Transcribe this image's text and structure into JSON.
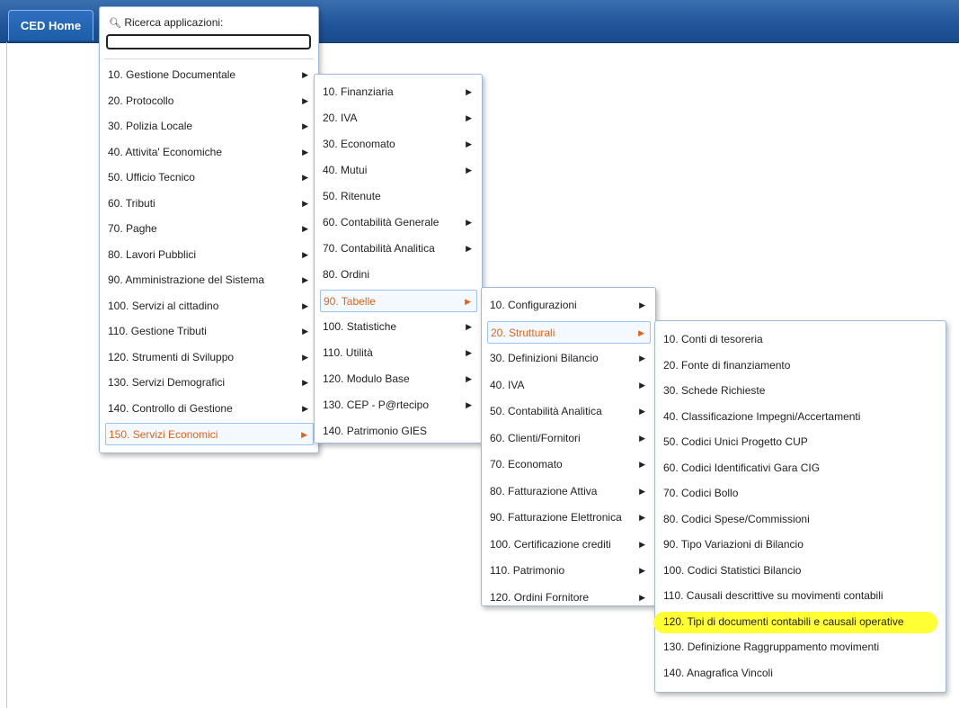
{
  "tabs": {
    "home": "CED Home"
  },
  "search": {
    "label": "Ricerca applicazioni:",
    "icon": "search-icon",
    "value": ""
  },
  "menu1": [
    {
      "label": "10. Gestione Documentale"
    },
    {
      "label": "20. Protocollo"
    },
    {
      "label": "30. Polizia Locale"
    },
    {
      "label": "40. Attivita' Economiche"
    },
    {
      "label": "50. Ufficio Tecnico"
    },
    {
      "label": "60. Tributi"
    },
    {
      "label": "70. Paghe"
    },
    {
      "label": "80. Lavori Pubblici"
    },
    {
      "label": "90. Amministrazione del Sistema"
    },
    {
      "label": "100. Servizi al cittadino"
    },
    {
      "label": "110. Gestione Tributi"
    },
    {
      "label": "120. Strumenti di Sviluppo"
    },
    {
      "label": "130. Servizi Demografici"
    },
    {
      "label": "140. Controllo di Gestione"
    },
    {
      "label": "150. Servizi Economici"
    }
  ],
  "menu2": [
    {
      "label": "10. Finanziaria"
    },
    {
      "label": "20. IVA"
    },
    {
      "label": "30. Economato"
    },
    {
      "label": "40. Mutui"
    },
    {
      "label": "50. Ritenute"
    },
    {
      "label": "60. Contabilità Generale"
    },
    {
      "label": "70. Contabilità Analitica"
    },
    {
      "label": "80. Ordini"
    },
    {
      "label": "90. Tabelle"
    },
    {
      "label": "100. Statistiche"
    },
    {
      "label": "110. Utilità"
    },
    {
      "label": "120. Modulo Base"
    },
    {
      "label": "130. CEP - P@rtecipo"
    },
    {
      "label": "140. Patrimonio GIES"
    }
  ],
  "menu3": [
    {
      "label": "10. Configurazioni"
    },
    {
      "label": "20. Strutturali"
    },
    {
      "label": "30. Definizioni Bilancio"
    },
    {
      "label": "40. IVA"
    },
    {
      "label": "50. Contabilità Analitica"
    },
    {
      "label": "60. Clienti/Fornitori"
    },
    {
      "label": "70. Economato"
    },
    {
      "label": "80. Fatturazione Attiva"
    },
    {
      "label": "90. Fatturazione Elettronica"
    },
    {
      "label": "100. Certificazione crediti"
    },
    {
      "label": "110. Patrimonio"
    },
    {
      "label": "120. Ordini Fornitore"
    }
  ],
  "menu4": [
    {
      "label": "10. Conti di tesoreria"
    },
    {
      "label": "20. Fonte di finanziamento"
    },
    {
      "label": "30. Schede Richieste"
    },
    {
      "label": "40. Classificazione Impegni/Accertamenti"
    },
    {
      "label": "50. Codici Unici Progetto CUP"
    },
    {
      "label": "60. Codici Identificativi Gara CIG"
    },
    {
      "label": "70. Codici Bollo"
    },
    {
      "label": "80. Codici Spese/Commissioni"
    },
    {
      "label": "90. Tipo Variazioni di Bilancio"
    },
    {
      "label": "100. Codici Statistici Bilancio"
    },
    {
      "label": "110. Causali descrittive su movimenti contabili"
    },
    {
      "label": "120. Tipi di documenti contabili e causali operative"
    },
    {
      "label": "130. Definizione Raggruppamento movimenti"
    },
    {
      "label": "140. Anagrafica Vincoli"
    }
  ],
  "colors": {
    "accent": "#e0651c",
    "highlight": "#ffff33",
    "topbar": "#1f5599"
  }
}
